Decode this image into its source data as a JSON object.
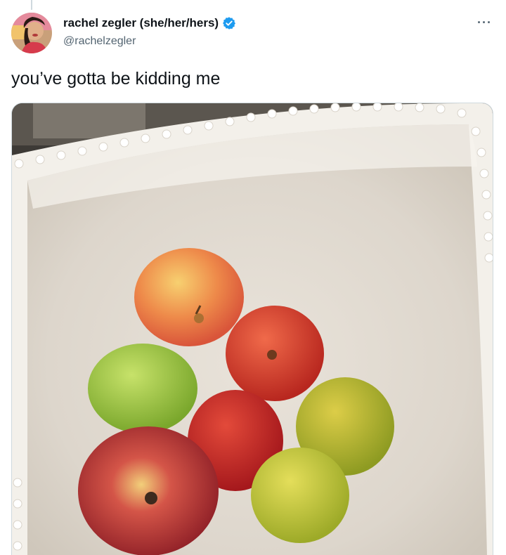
{
  "tweet": {
    "display_name": "rachel zegler (she/her/hers)",
    "handle": "@rachelzegler",
    "verified": true,
    "text": "you’ve gotta be kidding me",
    "more_label": "···"
  },
  "media": {
    "description_icon": "photo",
    "apples": [
      {
        "color": "yellow-red"
      },
      {
        "color": "red"
      },
      {
        "color": "green"
      },
      {
        "color": "red"
      },
      {
        "color": "yellow-green"
      },
      {
        "color": "red"
      },
      {
        "color": "yellow-green"
      }
    ]
  },
  "colors": {
    "verified": "#1d9bf0",
    "handle": "#536471",
    "text": "#0f1419"
  }
}
